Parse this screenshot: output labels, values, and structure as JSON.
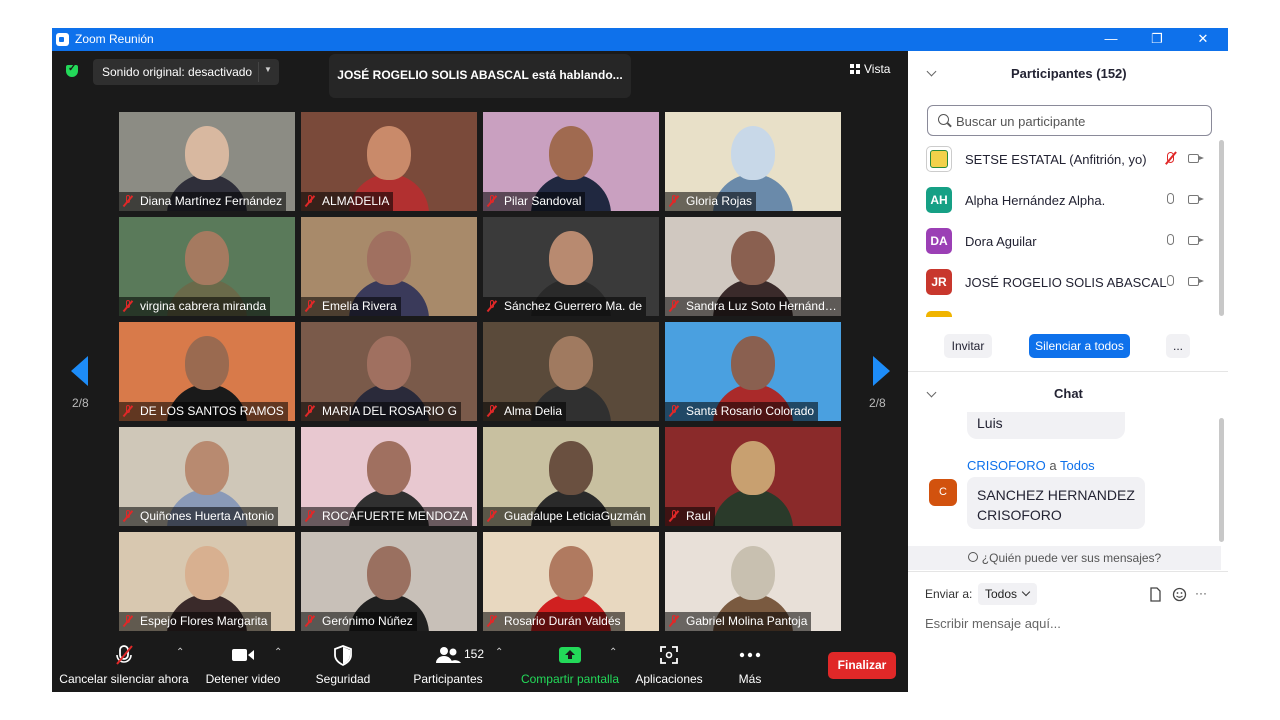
{
  "window": {
    "title": "Zoom Reunión",
    "minimize": "—",
    "restore": "❐",
    "close": "✕"
  },
  "top": {
    "original_sound": "Sonido original: desactivado",
    "speaker_banner": "JOSÉ ROGELIO SOLIS ABASCAL está hablando...",
    "view_label": "Vista"
  },
  "pagination": {
    "left": "2/8",
    "right": "2/8"
  },
  "tiles": [
    "Diana Martínez Fernández",
    "ALMADELIA",
    "Pilar Sandoval",
    "Gloria Rojas",
    "virgina cabrera miranda",
    "Emelia Rivera",
    "Sánchez Guerrero Ma. de",
    "Sandra Luz Soto Hernández",
    "DE LOS SANTOS RAMOS",
    "MARIA DEL ROSARIO G",
    "Alma Delia",
    "Santa Rosario Colorado",
    "Quiñones Huerta Antonio",
    "ROCAFUERTE MENDOZA",
    "Guadalupe LeticiaGuzmán",
    "Raul",
    "Espejo Flores Margarita",
    "Gerónimo Núñez",
    "Rosario Durán Valdés",
    "Gabriel Molina Pantoja"
  ],
  "toolbar": {
    "unmute": "Cancelar silenciar ahora",
    "stop_video": "Detener video",
    "security": "Seguridad",
    "participants": "Participantes",
    "participants_count": "152",
    "share": "Compartir pantalla",
    "apps": "Aplicaciones",
    "more": "Más",
    "end": "Finalizar"
  },
  "participants_panel": {
    "title": "Participantes (152)",
    "search_placeholder": "Buscar un participante",
    "rows": [
      {
        "initials": "",
        "name": "SETSE ESTATAL (Anfitrión, yo)",
        "color": "#ffffff",
        "muted": true
      },
      {
        "initials": "AH",
        "name": "Alpha Hernández Alpha.",
        "color": "#16a085",
        "muted": false
      },
      {
        "initials": "DA",
        "name": "Dora Aguilar",
        "color": "#9b3fb5",
        "muted": false
      },
      {
        "initials": "JR",
        "name": "JOSÉ ROGELIO SOLIS ABASCAL",
        "color": "#c8372d",
        "muted": false
      }
    ],
    "invite": "Invitar",
    "mute_all": "Silenciar a todos",
    "more": "..."
  },
  "chat": {
    "title": "Chat",
    "prev_message": "Luis",
    "sender": "CRISOFORO",
    "to_word": "a",
    "recipient": "Todos",
    "sender_initial": "C",
    "message_line1": "SANCHEZ HERNANDEZ",
    "message_line2": "CRISOFORO",
    "who_sees": "¿Quién puede ver sus mensajes?",
    "send_to_label": "Enviar a:",
    "send_to_value": "Todos",
    "input_placeholder": "Escribir mensaje aquí...",
    "more": "···"
  },
  "colors": {
    "zoom_blue": "#0e71eb",
    "end_red": "#e02828",
    "share_green": "#23d959",
    "dark_bg": "#1a1a1a"
  }
}
